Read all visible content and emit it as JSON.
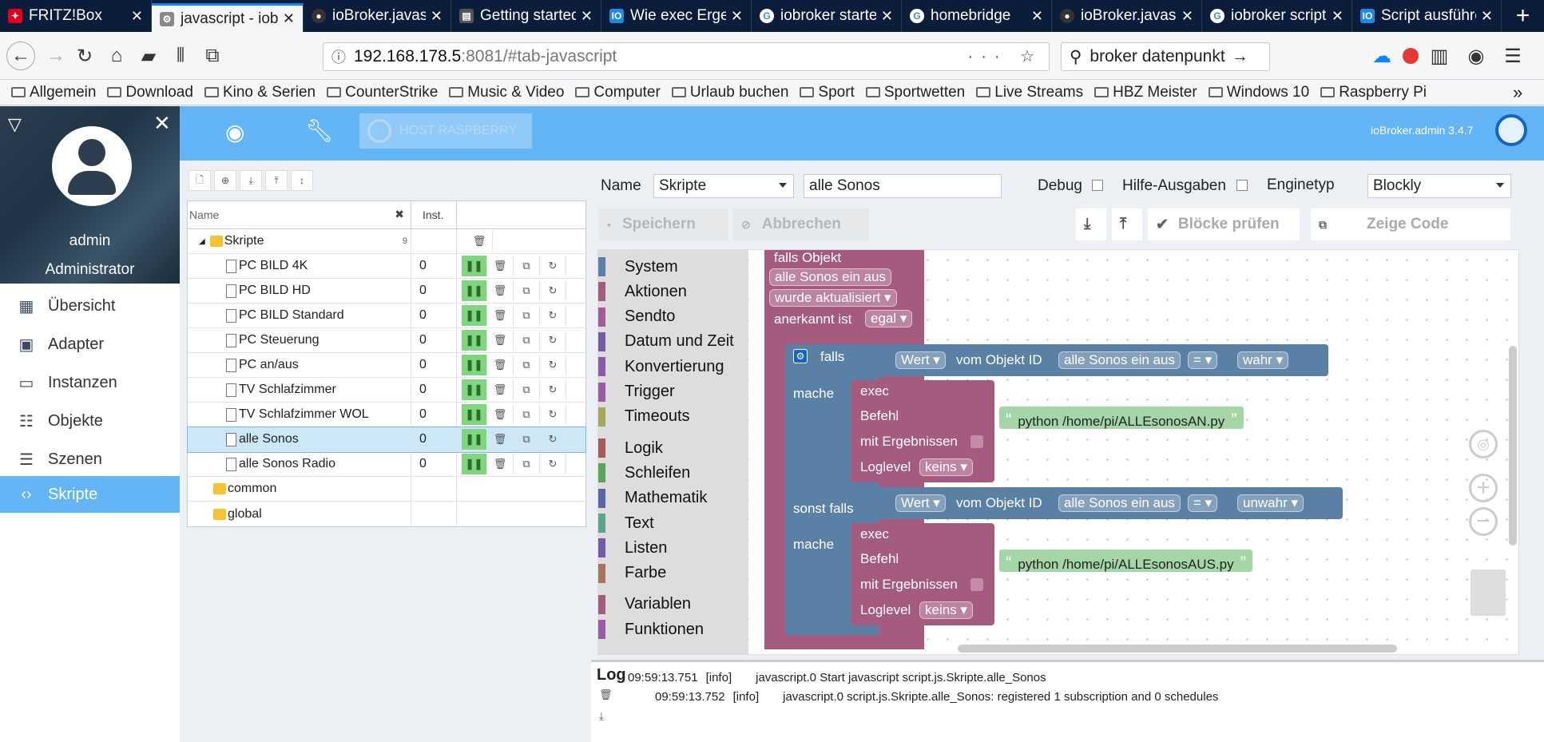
{
  "browser": {
    "tabs": [
      {
        "label": "FRITZ!Box",
        "color": "#e2001a"
      },
      {
        "label": "javascript - iobroker",
        "color": "#888888"
      },
      {
        "label": "ioBroker.javascript",
        "color": "#333333"
      },
      {
        "label": "Getting started",
        "color": "#555555"
      },
      {
        "label": "Wie exec Ergebnis",
        "color": "#1e88e5"
      },
      {
        "label": "iobroker starten",
        "color": "#4285f4"
      },
      {
        "label": "homebridge",
        "color": "#4285f4"
      },
      {
        "label": "ioBroker.javascript",
        "color": "#333333"
      },
      {
        "label": "iobroker script",
        "color": "#4285f4"
      },
      {
        "label": "Script ausführen",
        "color": "#1e88e5"
      }
    ],
    "url_host": "192.168.178.5",
    "url_rest": ":8081/#tab-javascript",
    "search_value": "broker datenpunkt",
    "bookmarks": [
      "Allgemein",
      "Download",
      "Kino & Serien",
      "CounterStrike",
      "Music & Video",
      "Computer",
      "Urlaub buchen",
      "Sport",
      "Sportwetten",
      "Live Streams",
      "HBZ Meister",
      "Windows 10",
      "Raspberry Pi"
    ]
  },
  "header": {
    "host_button": "HOST RASPBERRY",
    "version": "ioBroker.admin 3.4.7"
  },
  "user": {
    "name": "admin",
    "role": "Administrator"
  },
  "menu": [
    {
      "label": "Übersicht",
      "icon": "grid-icon"
    },
    {
      "label": "Adapter",
      "icon": "store-icon"
    },
    {
      "label": "Instanzen",
      "icon": "instances-icon"
    },
    {
      "label": "Objekte",
      "icon": "list-icon"
    },
    {
      "label": "Szenen",
      "icon": "scenes-icon"
    },
    {
      "label": "Skripte",
      "icon": "code-icon"
    }
  ],
  "list": {
    "col_name_placeholder": "Name",
    "col_inst": "Inst.",
    "root_folder": "Skripte",
    "root_count": "9",
    "scripts": [
      {
        "name": "PC BILD 4K",
        "inst": "0"
      },
      {
        "name": "PC BILD HD",
        "inst": "0"
      },
      {
        "name": "PC BILD Standard",
        "inst": "0"
      },
      {
        "name": "PC Steuerung",
        "inst": "0"
      },
      {
        "name": "PC an/aus",
        "inst": "0"
      },
      {
        "name": "TV Schlafzimmer",
        "inst": "0"
      },
      {
        "name": "TV Schlafzimmer WOL",
        "inst": "0"
      },
      {
        "name": "alle Sonos",
        "inst": "0"
      },
      {
        "name": "alle Sonos Radio",
        "inst": "0"
      }
    ],
    "folders": [
      "common",
      "global"
    ]
  },
  "editor": {
    "name_label": "Name",
    "folder_value": "Skripte",
    "script_name": "alle Sonos",
    "debug_label": "Debug",
    "help_label": "Hilfe-Ausgaben",
    "engine_label": "Enginetyp",
    "engine_value": "Blockly",
    "save": "Speichern",
    "cancel": "Abbrechen",
    "check": "Blöcke prüfen",
    "show_code": "Zeige Code"
  },
  "toolbox": [
    {
      "label": "System",
      "color": "#5b80a5"
    },
    {
      "label": "Aktionen",
      "color": "#a55b80"
    },
    {
      "label": "Sendto",
      "color": "#a55b99"
    },
    {
      "label": "Datum und Zeit",
      "color": "#745ba5"
    },
    {
      "label": "Konvertierung",
      "color": "#8c5ba5"
    },
    {
      "label": "Trigger",
      "color": "#9b5ba5"
    },
    {
      "label": "Timeouts",
      "color": "#a5a55b"
    },
    {
      "label": "Logik",
      "color": "#a55b5b"
    },
    {
      "label": "Schleifen",
      "color": "#5ba55b"
    },
    {
      "label": "Mathematik",
      "color": "#5b67a5"
    },
    {
      "label": "Text",
      "color": "#5ba58c"
    },
    {
      "label": "Listen",
      "color": "#745ba5"
    },
    {
      "label": "Farbe",
      "color": "#a5745b"
    },
    {
      "label": "Variablen",
      "color": "#a55b80"
    },
    {
      "label": "Funktionen",
      "color": "#995ba5"
    }
  ],
  "blocks": {
    "trigger_title": "falls Objekt",
    "trigger_object": "alle Sonos ein aus",
    "trigger_event": "wurde aktualisiert",
    "ack_label": "anerkannt ist",
    "ack_value": "egal",
    "if_label": "falls",
    "value_label": "Wert",
    "from_object_label": "vom Objekt ID",
    "object_id": "alle Sonos ein aus",
    "op": "=",
    "true_value": "wahr",
    "false_value": "unwahr",
    "do_label": "mache",
    "elseif_label": "sonst falls",
    "exec_label": "exec",
    "command_label": "Befehl",
    "results_label": "mit Ergebnissen",
    "loglevel_label": "Loglevel",
    "loglevel_value": "keins",
    "cmd_on": "python /home/pi/ALLEsonosAN.py",
    "cmd_off": "python /home/pi/ALLEsonosAUS.py"
  },
  "log": {
    "title": "Log",
    "entries": [
      {
        "time": "09:59:13.751",
        "level": "[info]",
        "msg": "javascript.0 Start javascript script.js.Skripte.alle_Sonos"
      },
      {
        "time": "09:59:13.752",
        "level": "[info]",
        "msg": "javascript.0 script.js.Skripte.alle_Sonos: registered 1 subscription and 0 schedules"
      }
    ]
  },
  "colors": {
    "accent": "#64b5f6",
    "event_block": "#a55b80",
    "logic_block": "#5b80a5",
    "string_block": "#a5d6a7"
  }
}
